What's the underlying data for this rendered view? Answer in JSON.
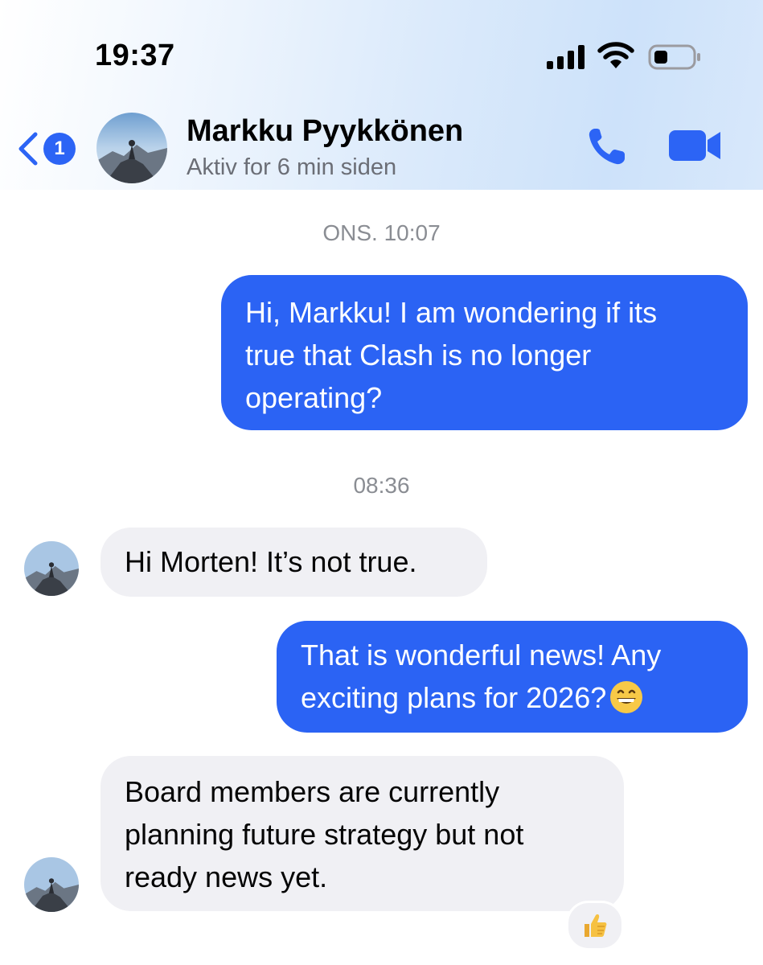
{
  "status_bar": {
    "time": "19:37"
  },
  "header": {
    "back_badge": "1",
    "contact_name": "Markku Pyykkönen",
    "contact_status": "Aktiv for 6 min siden"
  },
  "icons": {
    "back": "chevron-left-icon",
    "call": "phone-icon",
    "video": "video-camera-icon",
    "reaction": "thumbs-up-icon",
    "emoji": "grinning-face-emoji"
  },
  "colors": {
    "accent": "#2b63f4",
    "incoming_bubble": "#f0f0f4",
    "timestamp": "#8a8d93"
  },
  "conversation": {
    "timestamp_1": "ONS. 10:07",
    "msg_1": "Hi, Markku! I am wondering if its\ntrue that Clash is no longer\noperating?",
    "timestamp_2": "08:36",
    "msg_2": "Hi Morten! It’s not true.",
    "msg_3": "That is wonderful news! Any\nexciting plans for 2026?",
    "msg_4": "Board members are currently\nplanning future strategy but not\nready news yet."
  }
}
